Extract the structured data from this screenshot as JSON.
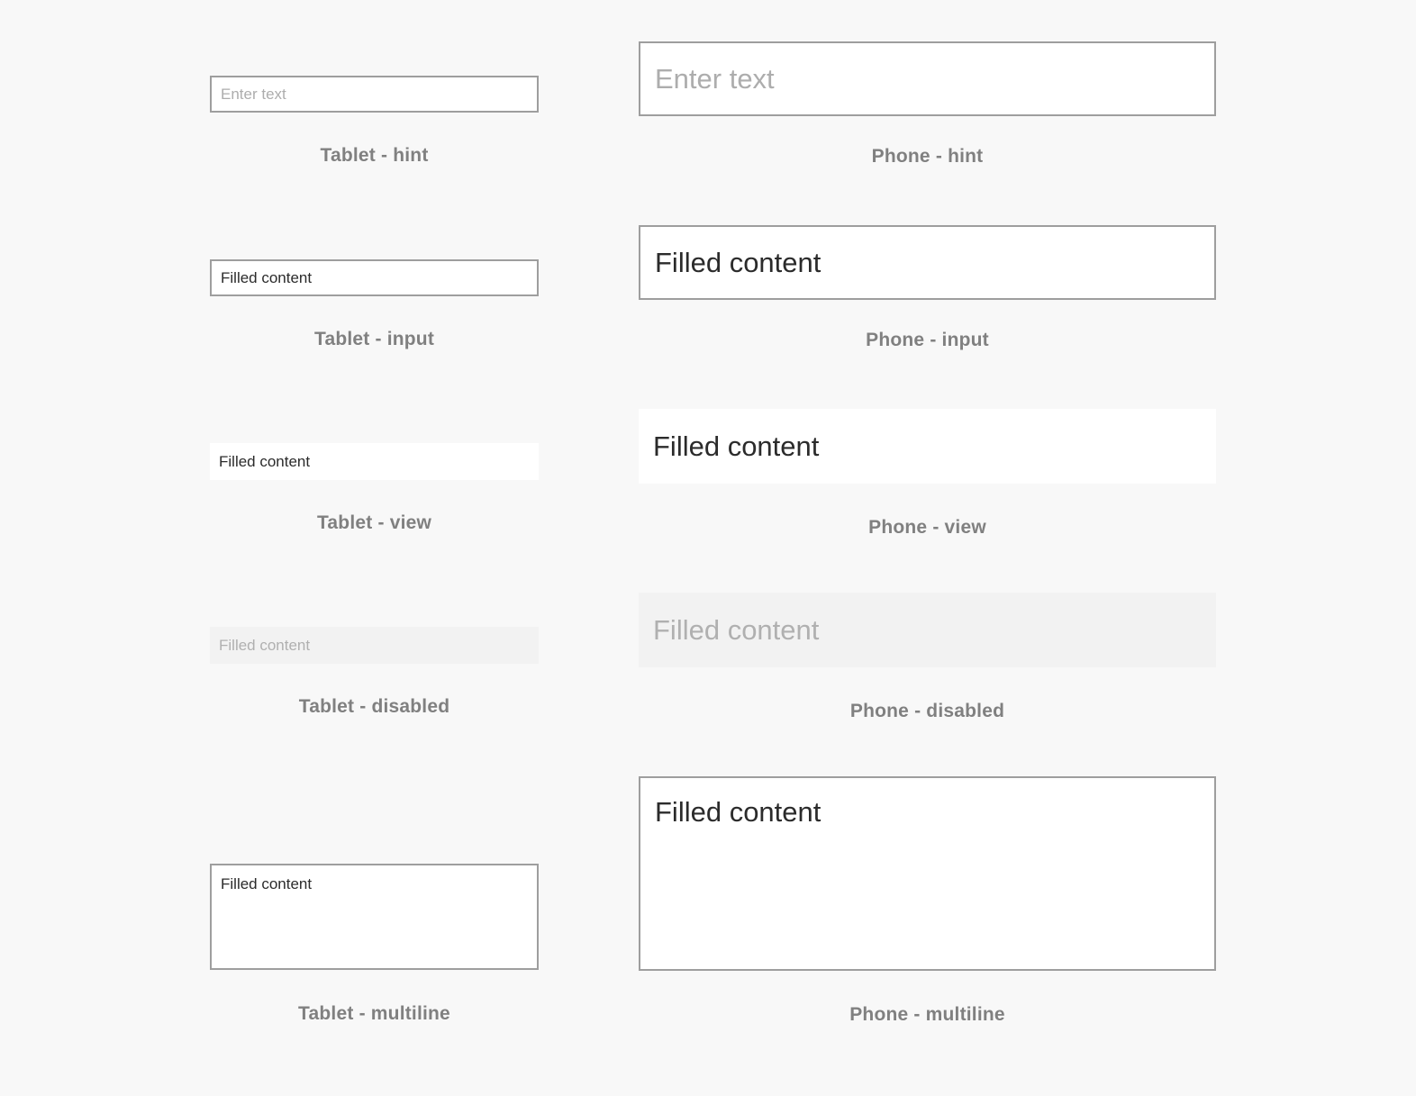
{
  "page": {
    "background_color": "#f8f8f8",
    "field_fill_color": "#ffffff",
    "field_border_color": "#9e9e9e",
    "disabled_fill_color": "#f2f2f2",
    "filled_text_color": "#2b2b2b",
    "hint_text_color": "#adadad",
    "disabled_text_color": "#b0b0b0",
    "caption_text_color": "#808080"
  },
  "columns": [
    {
      "device": "Tablet",
      "fields": [
        {
          "state": "hint",
          "value": "Enter text",
          "placeholder": "Enter text",
          "caption": "Tablet - hint"
        },
        {
          "state": "input",
          "value": "Filled content",
          "placeholder": "Enter text",
          "caption": "Tablet - input"
        },
        {
          "state": "view",
          "value": "Filled content",
          "placeholder": "Enter text",
          "caption": "Tablet - view"
        },
        {
          "state": "disabled",
          "value": "Filled content",
          "placeholder": "Enter text",
          "caption": "Tablet - disabled"
        },
        {
          "state": "multiline",
          "value": "Filled content",
          "placeholder": "Enter text",
          "caption": "Tablet - multiline"
        }
      ]
    },
    {
      "device": "Phone",
      "fields": [
        {
          "state": "hint",
          "value": "Enter text",
          "placeholder": "Enter text",
          "caption": "Phone - hint"
        },
        {
          "state": "input",
          "value": "Filled content",
          "placeholder": "Enter text",
          "caption": "Phone - input"
        },
        {
          "state": "view",
          "value": "Filled content",
          "placeholder": "Enter text",
          "caption": "Phone - view"
        },
        {
          "state": "disabled",
          "value": "Filled content",
          "placeholder": "Enter text",
          "caption": "Phone - disabled"
        },
        {
          "state": "multiline",
          "value": "Filled content",
          "placeholder": "Enter text",
          "caption": "Phone - multiline"
        }
      ]
    }
  ]
}
